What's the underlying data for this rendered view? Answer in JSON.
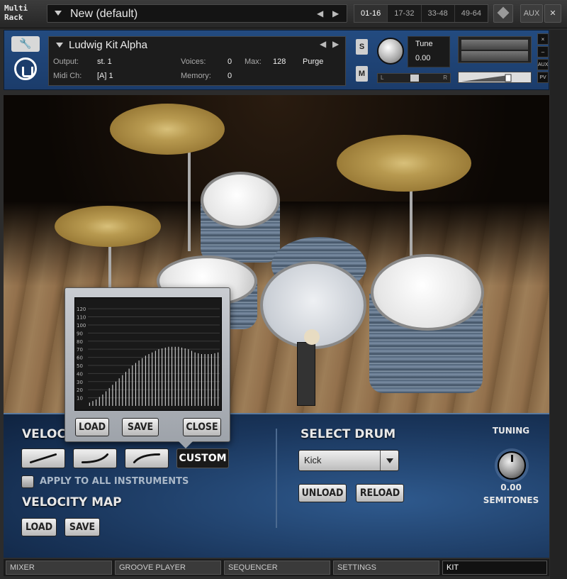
{
  "rack": {
    "label": "Multi\nRack",
    "preset_name": "New (default)",
    "prev_arrow": "◀",
    "next_arrow": "▶",
    "page_tabs": [
      "01-16",
      "17-32",
      "33-48",
      "49-64"
    ],
    "aux_label": "AUX"
  },
  "instrument": {
    "name": "Ludwig Kit Alpha",
    "output_label": "Output:",
    "output_value": "st. 1",
    "voices_label": "Voices:",
    "voices_value": "0",
    "max_label": "Max:",
    "max_value": "128",
    "purge_label": "Purge",
    "midi_label": "Midi Ch:",
    "midi_value": "[A]  1",
    "memory_label": "Memory:",
    "memory_value": "0",
    "solo_label": "S",
    "mute_label": "M",
    "tune_label": "Tune",
    "tune_value": "0.00",
    "pan_left": "L",
    "pan_right": "R",
    "close_label": "×",
    "minimize_label": "–",
    "aux_mini": "AUX",
    "pv_mini": "PV"
  },
  "velocity_popup": {
    "y_ticks": [
      "120",
      "110",
      "100",
      "90",
      "80",
      "70",
      "60",
      "50",
      "40",
      "30",
      "20",
      "10"
    ],
    "curve_values": [
      4,
      6,
      8,
      11,
      14,
      18,
      22,
      26,
      30,
      34,
      38,
      42,
      46,
      50,
      53,
      56,
      59,
      62,
      64,
      66,
      68,
      70,
      71,
      72,
      73,
      73,
      73,
      73,
      72,
      71,
      70,
      68,
      66,
      65,
      64,
      64,
      64,
      64,
      65,
      66
    ],
    "load_label": "LOAD",
    "save_label": "SAVE",
    "close_label": "CLOSE"
  },
  "velocity": {
    "heading": "VELOCITY",
    "custom_label": "CUSTOM",
    "apply_label": "APPLY TO ALL INSTRUMENTS",
    "map_heading": "VELOCITY MAP",
    "map_load_label": "LOAD",
    "map_save_label": "SAVE"
  },
  "select_drum": {
    "heading": "SELECT DRUM",
    "selected": "Kick",
    "unload_label": "UNLOAD",
    "reload_label": "RELOAD"
  },
  "tuning": {
    "heading": "TUNING",
    "value": "0.00",
    "unit": "SEMITONES"
  },
  "tabs": [
    "MIXER",
    "GROOVE PLAYER",
    "SEQUENCER",
    "SETTINGS",
    "KIT"
  ],
  "active_tab": "KIT"
}
